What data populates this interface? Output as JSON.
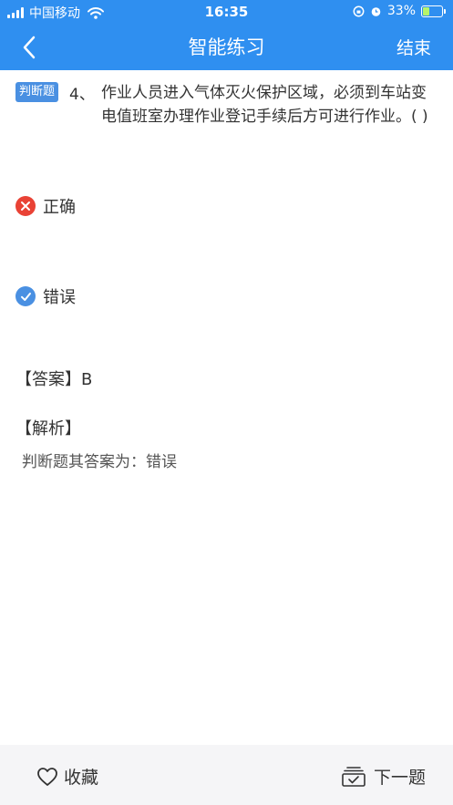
{
  "status_bar": {
    "carrier": "中国移动",
    "time": "16:35",
    "battery_percent": "33%",
    "battery_level": 0.33
  },
  "nav": {
    "title": "智能练习",
    "end_label": "结束"
  },
  "question": {
    "type_badge": "判断题",
    "number": "4、",
    "text": "作业人员进入气体灭火保护区域，必须到车站变电值班室办理作业登记手续后方可进行作业。( )"
  },
  "options": [
    {
      "label": "正确",
      "state": "wrong",
      "icon": "x-icon"
    },
    {
      "label": "错误",
      "state": "correct",
      "icon": "check-icon"
    }
  ],
  "answer": {
    "label": "【答案】B",
    "analysis_title": "【解析】",
    "analysis_text": "判断题其答案为：错误"
  },
  "bottom": {
    "favorite_label": "收藏",
    "next_label": "下一题"
  },
  "colors": {
    "header": "#2f8ff0",
    "badge": "#4a90e2",
    "wrong": "#e94235",
    "correct": "#4a90e2"
  }
}
